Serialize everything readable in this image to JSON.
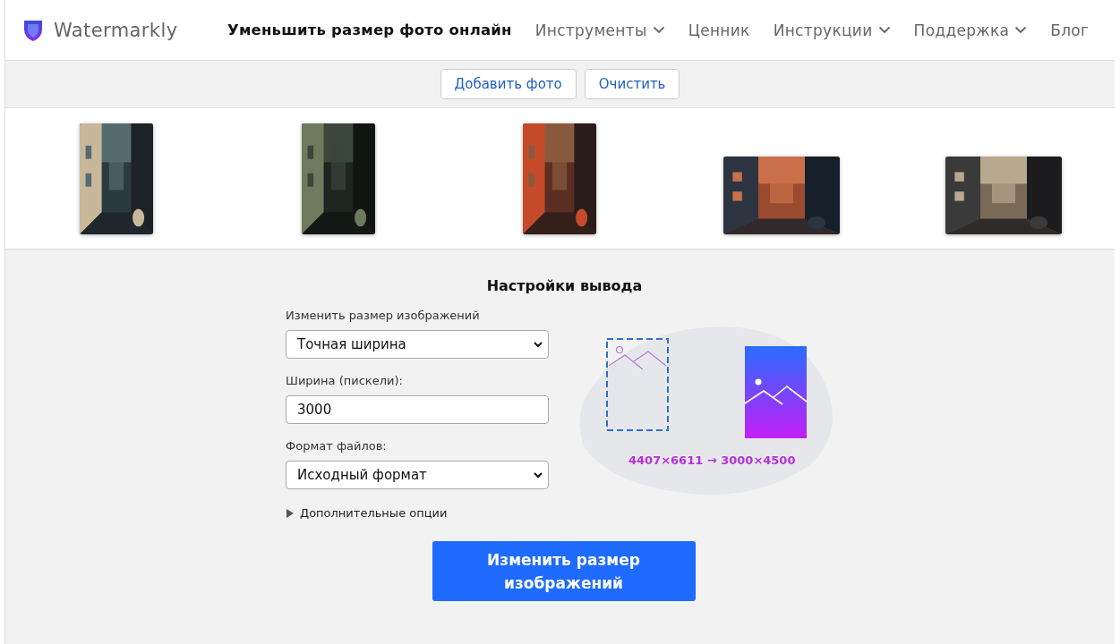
{
  "header": {
    "brand": "Watermarkly",
    "nav": [
      {
        "label": "Уменьшить размер фото онлайн",
        "selected": true,
        "dropdown": false
      },
      {
        "label": "Инструменты",
        "selected": false,
        "dropdown": true
      },
      {
        "label": "Ценник",
        "selected": false,
        "dropdown": false
      },
      {
        "label": "Инструкции",
        "selected": false,
        "dropdown": true
      },
      {
        "label": "Поддержка",
        "selected": false,
        "dropdown": true
      },
      {
        "label": "Блог",
        "selected": false,
        "dropdown": false
      }
    ]
  },
  "toolbar": {
    "buttons": [
      "Добавить фото",
      "Очистить"
    ]
  },
  "thumbnails": [
    {
      "kind": "portrait"
    },
    {
      "kind": "portrait"
    },
    {
      "kind": "portrait"
    },
    {
      "kind": "landscape"
    },
    {
      "kind": "landscape"
    }
  ],
  "settings": {
    "title": "Настройки вывода",
    "fields": [
      {
        "kind": "select",
        "label": "Изменить размер изображений",
        "value": "Точная ширина"
      },
      {
        "kind": "input",
        "label": "Ширина (пискели):",
        "value": "3000"
      },
      {
        "kind": "select",
        "label": "Формат файлов:",
        "value": "Исходный формат"
      }
    ],
    "more_options": {
      "label": "Дополнительные опции",
      "expanded": false
    },
    "preview": {
      "caption": "4407×6611 → 3000×4500"
    },
    "submit": "Изменить размер изображений"
  }
}
